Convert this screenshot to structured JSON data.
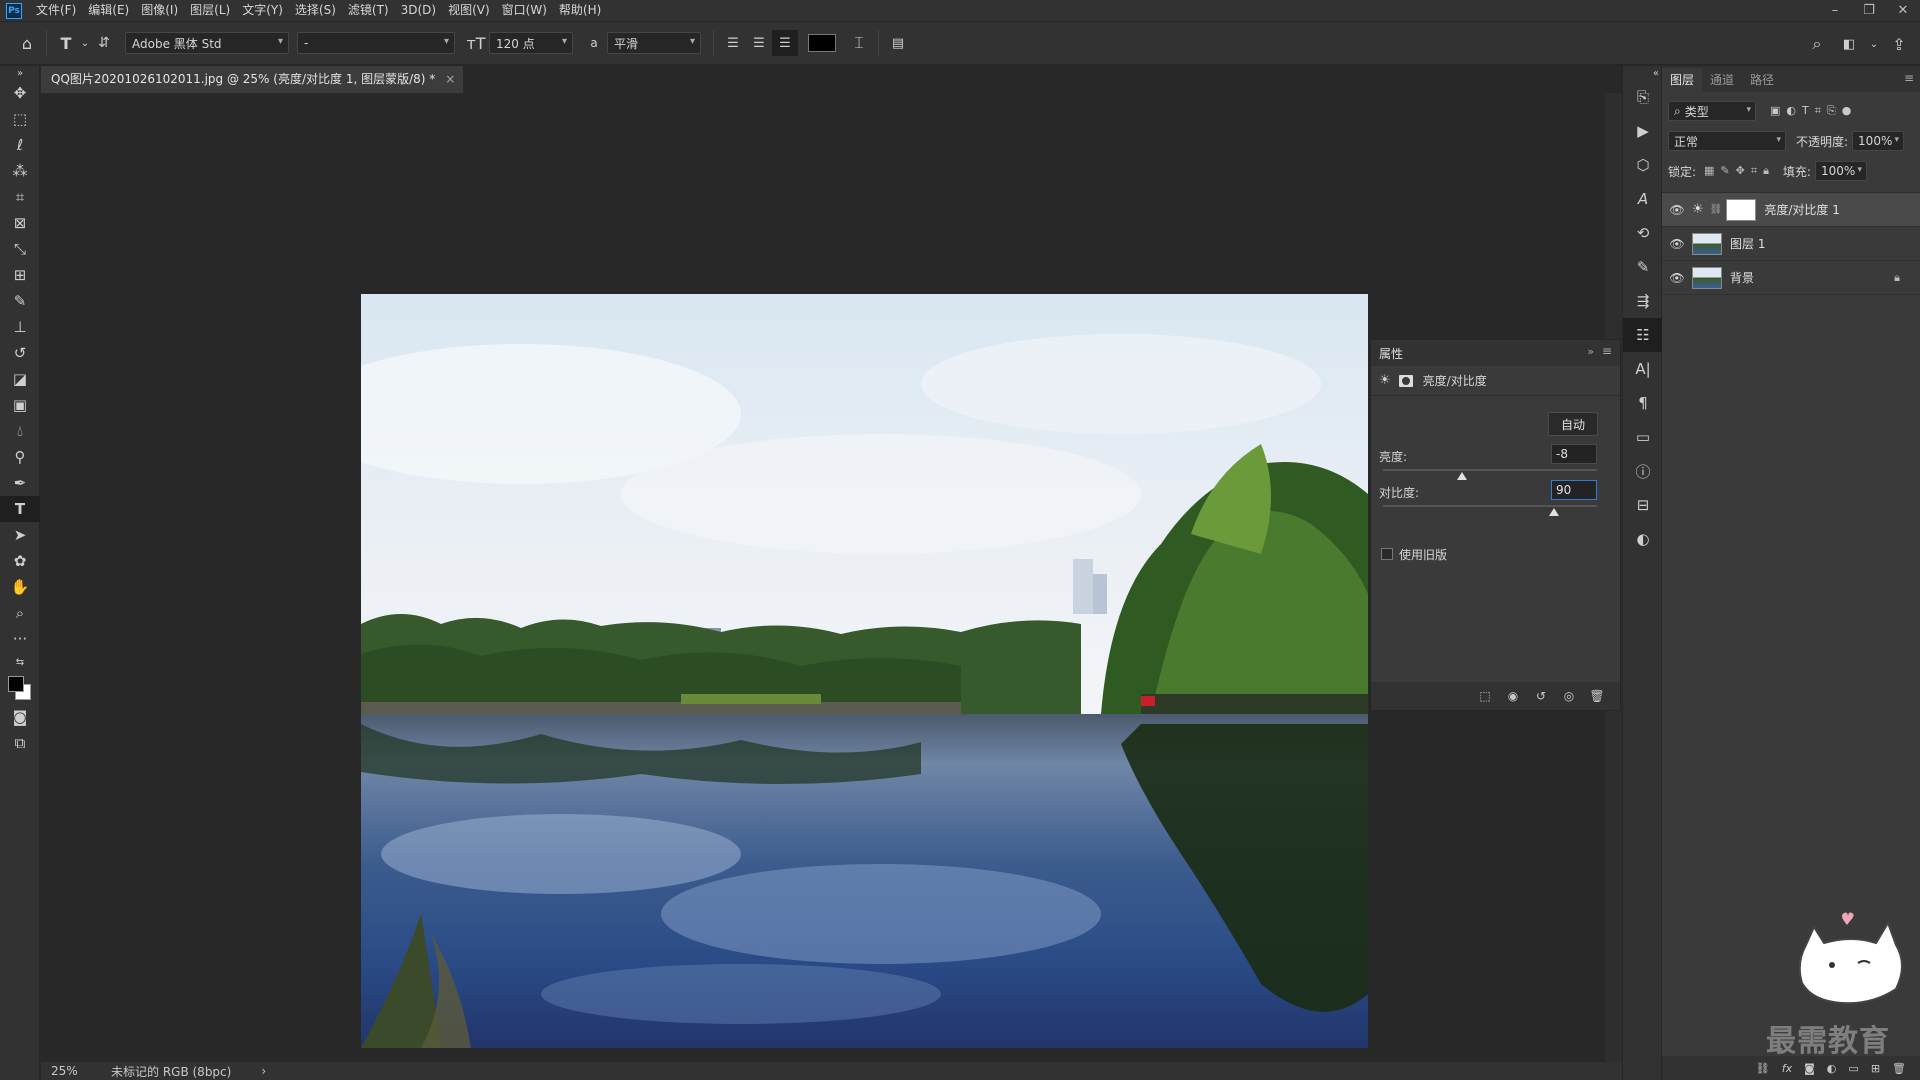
{
  "menubar": {
    "logo": "Ps",
    "items": [
      "文件(F)",
      "编辑(E)",
      "图像(I)",
      "图层(L)",
      "文字(Y)",
      "选择(S)",
      "滤镜(T)",
      "3D(D)",
      "视图(V)",
      "窗口(W)",
      "帮助(H)"
    ]
  },
  "options": {
    "font_family": "Adobe 黑体 Std",
    "font_style": "-",
    "font_size": "120 点",
    "aa_label": "a",
    "antialias": "平滑",
    "text_color": "#000000"
  },
  "document": {
    "tab_title": "QQ图片20201026102011.jpg @ 25% (亮度/对比度 1, 图层蒙版/8) *",
    "close": "×"
  },
  "statusbar": {
    "zoom": "25%",
    "info": "未标记的 RGB (8bpc)",
    "arrow": "›"
  },
  "properties": {
    "title": "属性",
    "collapse": "»",
    "menu": "≡",
    "adjustment_name": "亮度/对比度",
    "auto_label": "自动",
    "brightness_label": "亮度:",
    "brightness_value": "-8",
    "brightness_level_pct": 37,
    "contrast_label": "对比度:",
    "contrast_value": "90",
    "contrast_level_pct": 80,
    "legacy_label": "使用旧版"
  },
  "layers_panel": {
    "tabs": [
      "图层",
      "通道",
      "路径"
    ],
    "menu": "≡",
    "filter_kind": "类型",
    "blend_mode": "正常",
    "opacity_label": "不透明度:",
    "opacity_value": "100%",
    "lock_label": "锁定:",
    "fill_label": "填充:",
    "fill_value": "100%",
    "layers": [
      {
        "name": "亮度/对比度 1",
        "selected": true
      },
      {
        "name": "图层 1",
        "selected": false
      },
      {
        "name": "背景",
        "selected": false,
        "locked": true
      }
    ]
  },
  "watermark": "最需教育",
  "colors": {
    "accent": "#31a8ff",
    "panel": "#3a3a3a",
    "chrome": "#323232",
    "canvas": "#282828"
  }
}
